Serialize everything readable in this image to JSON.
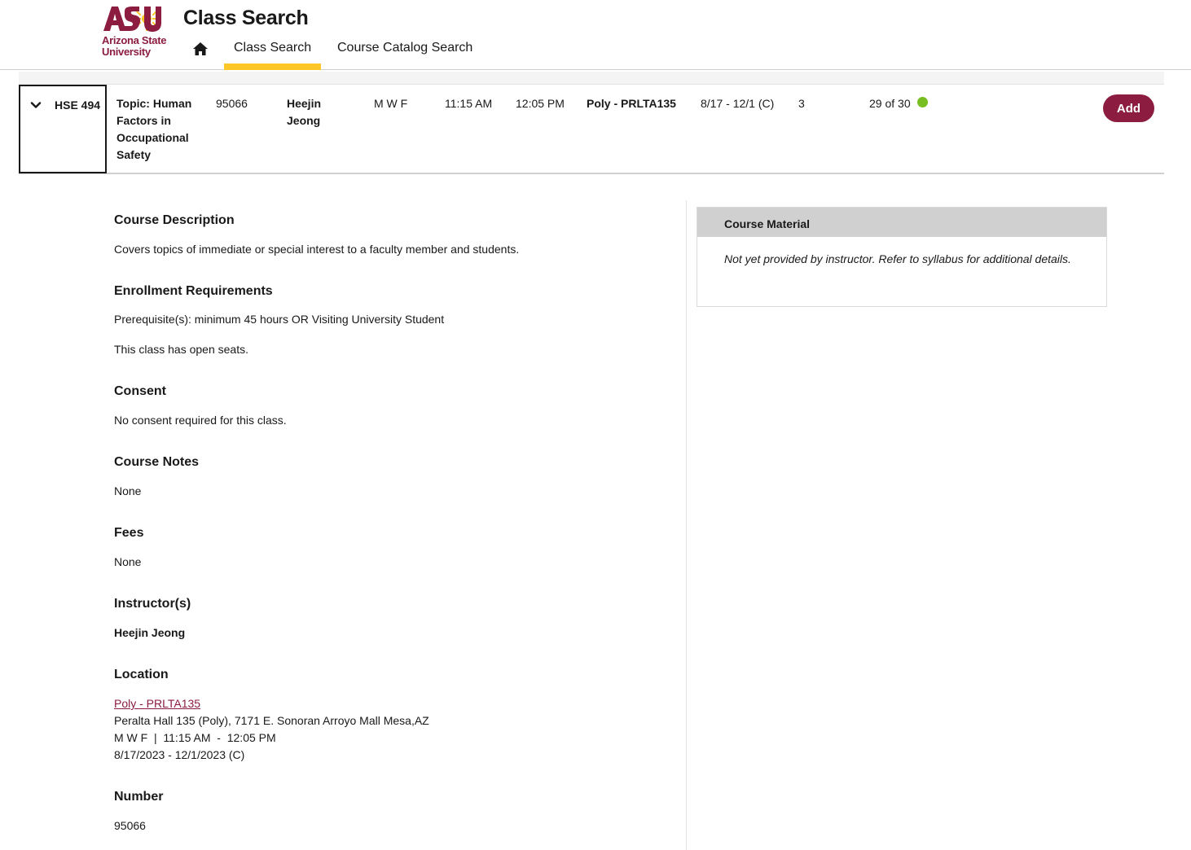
{
  "brand": {
    "logo_line1": "Arizona State",
    "logo_line2": "University",
    "logo_mark": "ASU",
    "maroon": "#8c1d40",
    "gold": "#ffc627"
  },
  "header": {
    "title": "Class Search",
    "nav": {
      "home_icon": "home-icon",
      "tabs": [
        {
          "label": "Class Search",
          "active": true
        },
        {
          "label": "Course Catalog Search",
          "active": false
        }
      ]
    }
  },
  "result": {
    "course": "HSE 494",
    "title": "Topic: Human Factors in Occupational Safety",
    "title_lines": [
      "Topic: Human",
      "Factors in",
      "Occupational",
      "Safety"
    ],
    "number": "95066",
    "instructor_lines": [
      "Heejin",
      "Jeong"
    ],
    "days": "M W F",
    "start": "11:15 AM",
    "end": "12:05 PM",
    "location": "Poly - PRLTA135",
    "dates": "8/17 - 12/1 (C)",
    "units": "3",
    "seats": "29 of 30",
    "seats_status_color": "#78be20",
    "add_label": "Add"
  },
  "detail": {
    "description": {
      "heading": "Course Description",
      "text": "Covers topics of immediate or special interest to a faculty member and students."
    },
    "enrollment": {
      "heading": "Enrollment Requirements",
      "text": "Prerequisite(s): minimum 45 hours OR Visiting University Student",
      "seats_text": "This class has open seats."
    },
    "consent": {
      "heading": "Consent",
      "text": "No consent required for this class."
    },
    "notes": {
      "heading": "Course Notes",
      "text": "None"
    },
    "fees": {
      "heading": "Fees",
      "text": "None"
    },
    "instructors": {
      "heading": "Instructor(s)",
      "name": "Heejin Jeong"
    },
    "location": {
      "heading": "Location",
      "link": "Poly - PRLTA135",
      "address": "Peralta Hall 135 (Poly), 7171 E. Sonoran Arroyo Mall Mesa,AZ",
      "schedule": "M W F  |  11:15 AM  -  12:05 PM",
      "dates": "8/17/2023 - 12/1/2023 (C)"
    },
    "number": {
      "heading": "Number",
      "value": "95066"
    }
  },
  "material": {
    "heading": "Course Material",
    "text": "Not yet provided by instructor. Refer to syllabus for additional details."
  }
}
